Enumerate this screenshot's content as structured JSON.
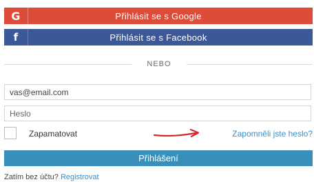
{
  "social": {
    "google_label": "Přihlásit se s Google",
    "facebook_label": "Přihlásit se s Facebook",
    "google_color": "#dd4b39",
    "facebook_color": "#3b5998",
    "google_icon": "google-icon",
    "facebook_icon": "facebook-icon"
  },
  "divider": {
    "text": "NEBO"
  },
  "form": {
    "email_value": "vas@email.com",
    "password_placeholder": "Heslo",
    "remember_label": "Zapamatovat",
    "remember_checked": false,
    "forgot_link": "Zapomněli jste heslo?",
    "submit_label": "Přihlášení",
    "submit_color": "#3a8fba"
  },
  "footer": {
    "prompt": "Zatím bez účtu?",
    "register_link": "Registrovat"
  },
  "annotation": {
    "arrow_color": "#d9262e",
    "arrow_icon": "red-arrow-annotation"
  }
}
